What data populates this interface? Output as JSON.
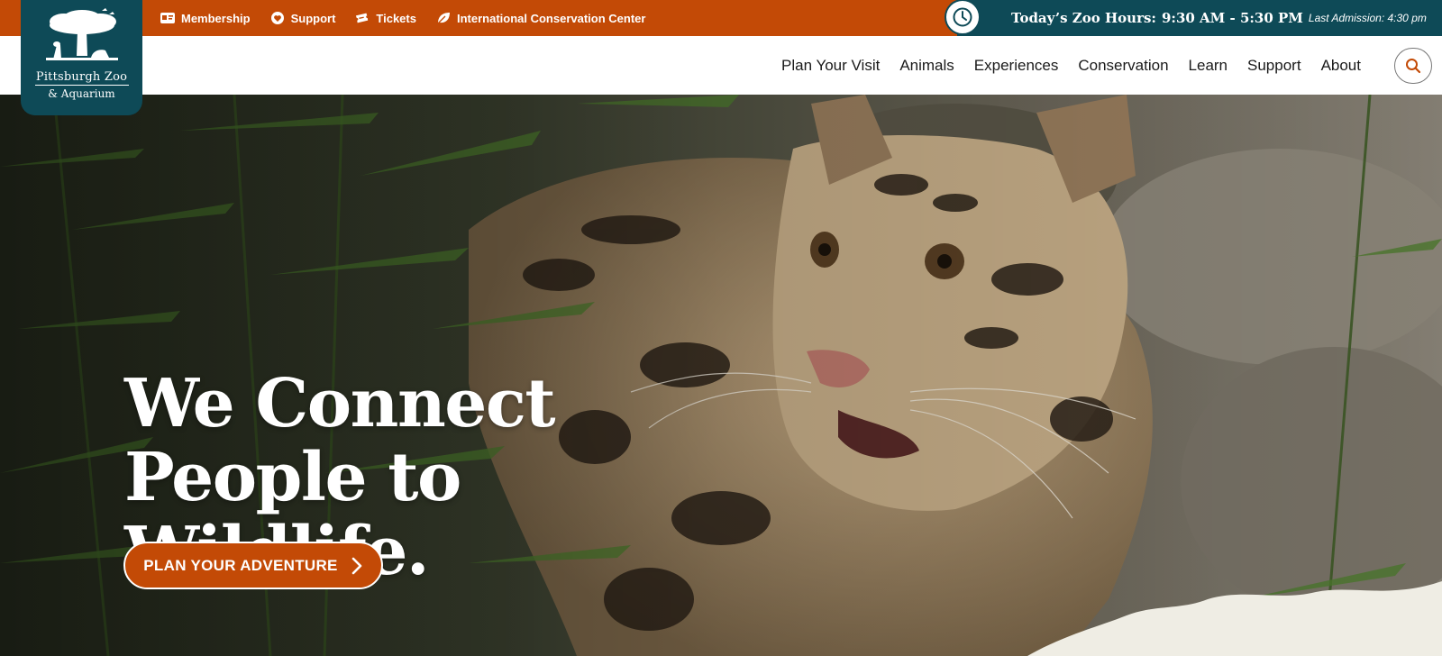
{
  "utility_links": [
    {
      "label": "Membership",
      "icon": "id-card-icon"
    },
    {
      "label": "Support",
      "icon": "heart-icon"
    },
    {
      "label": "Tickets",
      "icon": "ticket-icon"
    },
    {
      "label": "International Conservation Center",
      "icon": "leaf-icon"
    }
  ],
  "hours": {
    "title": "Today’s Zoo Hours:",
    "time": "9:30 AM - 5:30 PM",
    "last_admission": "Last Admission: 4:30 pm",
    "icon": "clock-icon"
  },
  "logo": {
    "line1": "Pittsburgh Zoo",
    "line2": "& Aquarium",
    "icon": "tree-logo-icon"
  },
  "nav": {
    "items": [
      "Plan Your Visit",
      "Animals",
      "Experiences",
      "Conservation",
      "Learn",
      "Support",
      "About"
    ],
    "search_icon": "search-icon"
  },
  "hero": {
    "headline": "We Connect People to Wildlife.",
    "cta_label": "PLAN YOUR ADVENTURE",
    "cta_icon": "chevron-right-icon"
  },
  "colors": {
    "accent_orange": "#c34a06",
    "brand_teal": "#0e4a57",
    "white": "#ffffff"
  }
}
